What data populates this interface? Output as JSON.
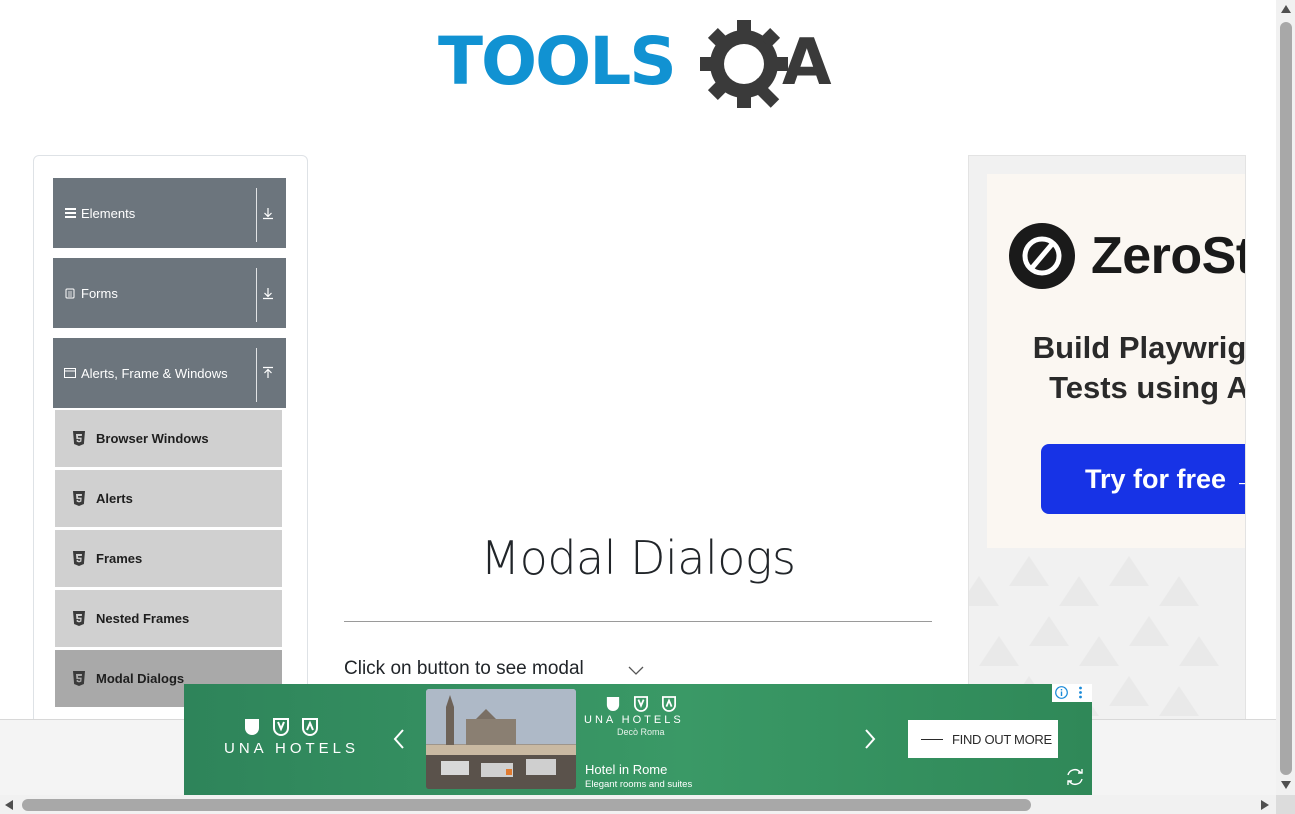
{
  "brand": {
    "logo_text": "TOOLSQA",
    "logo_part1": "TOOLS",
    "logo_part2": "A",
    "primary_color": "#1192d2",
    "dark_color": "#3a3a3a"
  },
  "sidebar": {
    "groups": [
      {
        "label": "Elements",
        "icon": "hamburger-icon",
        "state": "collapsed"
      },
      {
        "label": "Forms",
        "icon": "form-icon",
        "state": "collapsed"
      },
      {
        "label": "Alerts, Frame & Windows",
        "icon": "window-icon",
        "state": "expanded"
      }
    ],
    "items": [
      {
        "label": "Browser Windows",
        "icon": "html5-icon"
      },
      {
        "label": "Alerts",
        "icon": "html5-icon"
      },
      {
        "label": "Frames",
        "icon": "html5-icon"
      },
      {
        "label": "Nested Frames",
        "icon": "html5-icon"
      },
      {
        "label": "Modal Dialogs",
        "icon": "html5-icon",
        "active": true
      }
    ],
    "colors": {
      "header_bg": "#6c757d",
      "item_bg": "#d0d0d0",
      "active_bg": "#a9a9a9"
    }
  },
  "main": {
    "title": "Modal Dialogs",
    "hint": "Click on button to see modal"
  },
  "side_ad": {
    "brand": "ZeroSte",
    "line1": "Build Playwrigh",
    "line2": "Tests using A",
    "cta": "Try for free →",
    "cta_color": "#1733e6"
  },
  "banner_ad": {
    "logo_text": "UNA HOTELS",
    "logo_sub": "Decò Roma",
    "hotel_title": "Hotel in Rome",
    "hotel_sub": "Elegant rooms and suites",
    "cta": "FIND OUT MORE",
    "bg_color": "#2e8a5a"
  }
}
